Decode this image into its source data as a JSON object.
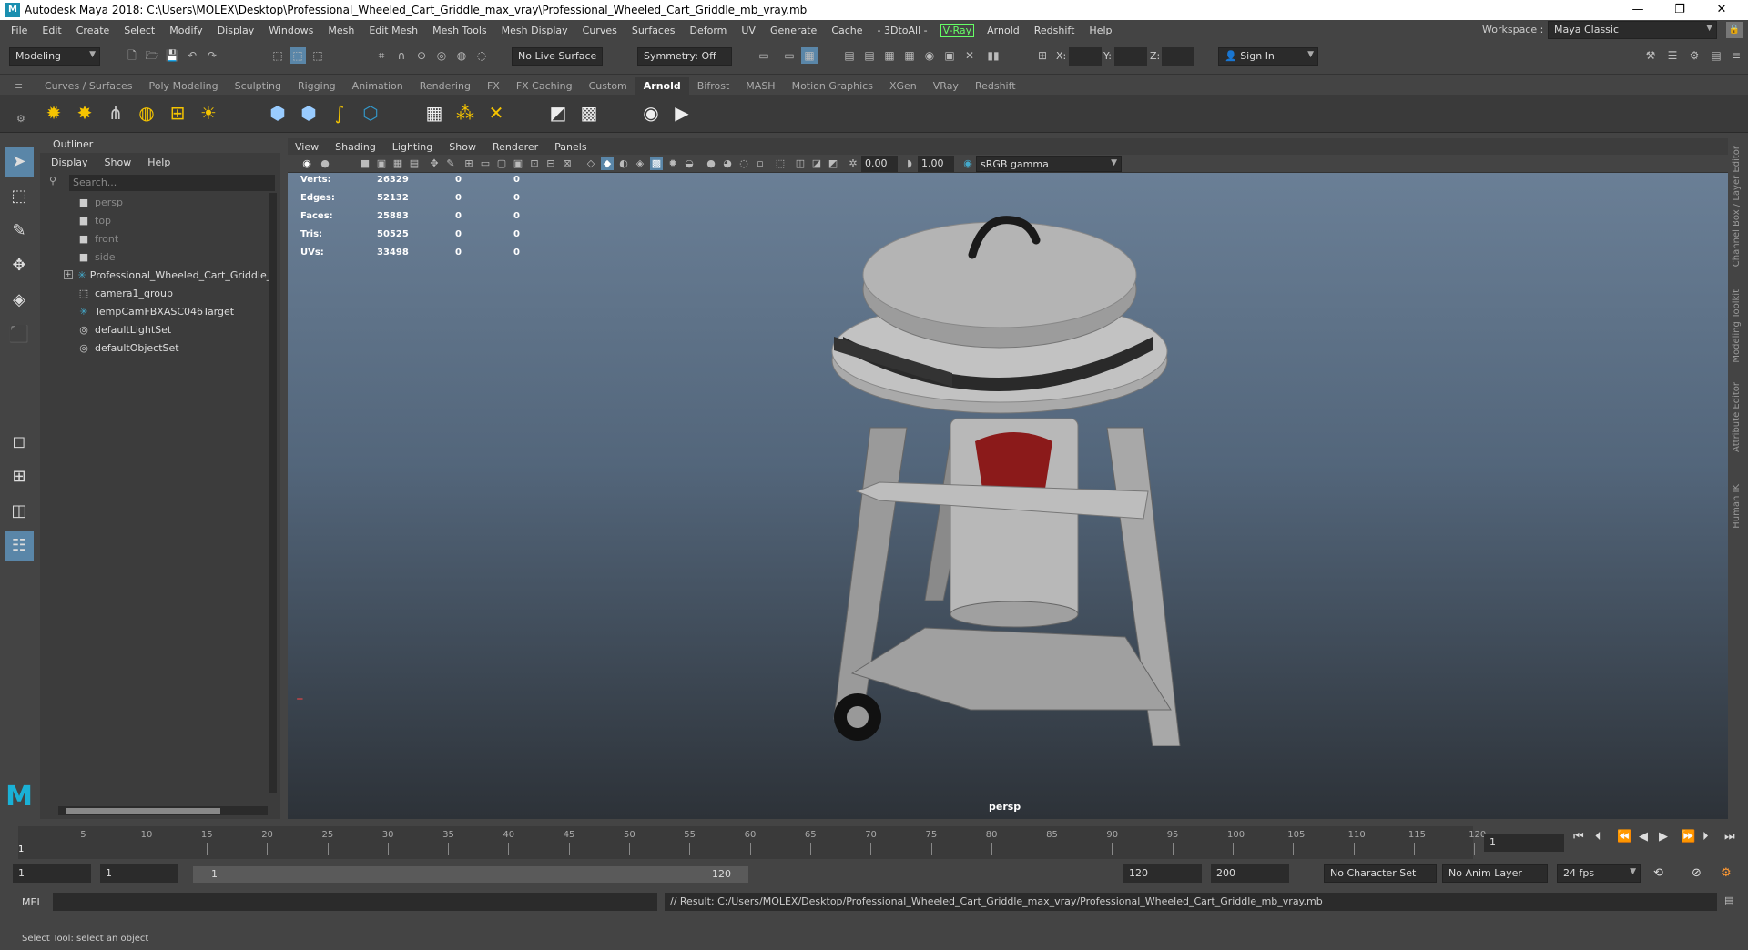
{
  "window": {
    "title": "Autodesk Maya 2018: C:\\Users\\MOLEX\\Desktop\\Professional_Wheeled_Cart_Griddle_max_vray\\Professional_Wheeled_Cart_Griddle_mb_vray.mb",
    "minimize": "—",
    "restore": "❐",
    "close": "✕"
  },
  "menubar": {
    "items": [
      "File",
      "Edit",
      "Create",
      "Select",
      "Modify",
      "Display",
      "Windows",
      "Mesh",
      "Edit Mesh",
      "Mesh Tools",
      "Mesh Display",
      "Curves",
      "Surfaces",
      "Deform",
      "UV",
      "Generate",
      "Cache",
      "- 3DtoAll -"
    ],
    "vray": "V-Ray",
    "items2": [
      "Arnold",
      "Redshift",
      "Help"
    ],
    "workspace_label": "Workspace :",
    "workspace_value": "Maya Classic"
  },
  "status": {
    "mode": "Modeling",
    "live_surface": "No Live Surface",
    "symmetry": "Symmetry: Off",
    "x_label": "X:",
    "y_label": "Y:",
    "z_label": "Z:",
    "sign_in": "Sign In"
  },
  "shelf": {
    "tabs": [
      "Curves / Surfaces",
      "Poly Modeling",
      "Sculpting",
      "Rigging",
      "Animation",
      "Rendering",
      "FX",
      "FX Caching",
      "Custom",
      "Arnold",
      "Bifrost",
      "MASH",
      "Motion Graphics",
      "XGen",
      "VRay",
      "Redshift"
    ],
    "active": "Arnold"
  },
  "outliner": {
    "title": "Outliner",
    "menus": [
      "Display",
      "Show",
      "Help"
    ],
    "search_placeholder": "Search...",
    "items": [
      {
        "label": "persp",
        "icon": "camera-icon"
      },
      {
        "label": "top",
        "icon": "camera-icon"
      },
      {
        "label": "front",
        "icon": "camera-icon"
      },
      {
        "label": "side",
        "icon": "camera-icon"
      },
      {
        "label": "Professional_Wheeled_Cart_Griddle_r",
        "icon": "transform-icon"
      },
      {
        "label": "camera1_group",
        "icon": "group-icon"
      },
      {
        "label": "TempCamFBXASC046Target",
        "icon": "transform-icon"
      },
      {
        "label": "defaultLightSet",
        "icon": "set-icon"
      },
      {
        "label": "defaultObjectSet",
        "icon": "set-icon"
      }
    ]
  },
  "viewport": {
    "menus": [
      "View",
      "Shading",
      "Lighting",
      "Show",
      "Renderer",
      "Panels"
    ],
    "exposure": "0.00",
    "gamma": "1.00",
    "colorspace": "sRGB gamma",
    "camera": "persp",
    "hud": [
      {
        "label": "Verts:",
        "v": "26329",
        "a": "0",
        "b": "0"
      },
      {
        "label": "Edges:",
        "v": "52132",
        "a": "0",
        "b": "0"
      },
      {
        "label": "Faces:",
        "v": "25883",
        "a": "0",
        "b": "0"
      },
      {
        "label": "Tris:",
        "v": "50525",
        "a": "0",
        "b": "0"
      },
      {
        "label": "UVs:",
        "v": "33498",
        "a": "0",
        "b": "0"
      }
    ]
  },
  "sidetabs": [
    "Channel Box / Layer Editor",
    "Modeling Toolkit",
    "Attribute Editor",
    "Human IK"
  ],
  "timeline": {
    "ticks": [
      "5",
      "10",
      "15",
      "20",
      "25",
      "30",
      "35",
      "40",
      "45",
      "50",
      "55",
      "60",
      "65",
      "70",
      "75",
      "80",
      "85",
      "90",
      "95",
      "100",
      "105",
      "110",
      "115",
      "120"
    ],
    "current": "1",
    "current_field": "1"
  },
  "range": {
    "start": "1",
    "start2": "1",
    "slider_start": "1",
    "slider_end": "120",
    "end": "120",
    "end2": "200",
    "charset": "No Character Set",
    "animlayer": "No Anim Layer",
    "fps": "24 fps"
  },
  "cmd": {
    "lang": "MEL",
    "result": "// Result: C:/Users/MOLEX/Desktop/Professional_Wheeled_Cart_Griddle_max_vray/Professional_Wheeled_Cart_Griddle_mb_vray.mb"
  },
  "help": "Select Tool: select an object"
}
